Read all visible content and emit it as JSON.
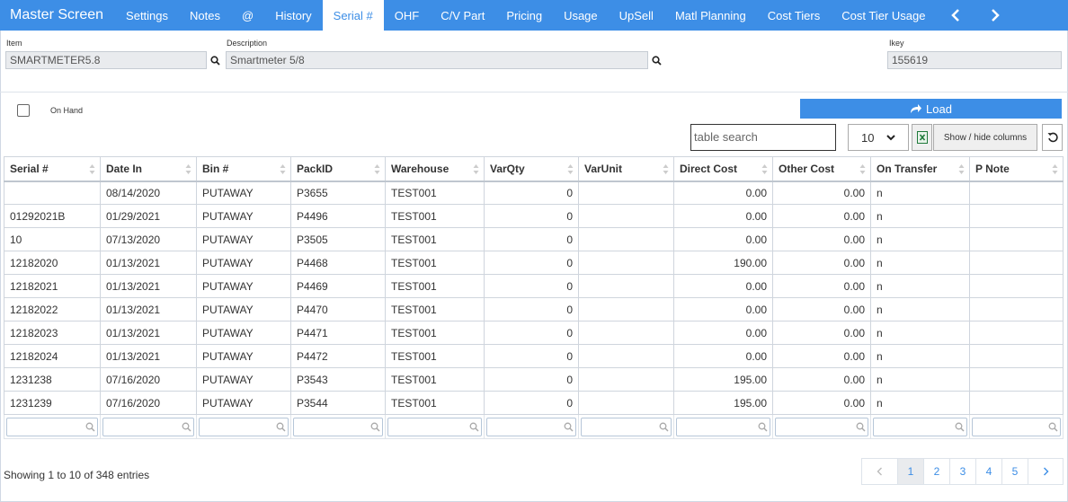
{
  "nav": {
    "brand": "Master Screen",
    "tabs": [
      "Settings",
      "Notes",
      "@",
      "History",
      "Serial #",
      "OHF",
      "C/V Part",
      "Pricing",
      "Usage",
      "UpSell",
      "Matl Planning",
      "Cost Tiers",
      "Cost Tier Usage"
    ],
    "active_tab": "Serial #"
  },
  "fields": {
    "item_label": "Item",
    "item_value": "SMARTMETER5.8",
    "description_label": "Description",
    "description_value": "Smartmeter 5/8",
    "ikey_label": "Ikey",
    "ikey_value": "155619"
  },
  "options": {
    "on_hand_label": "On Hand",
    "on_hand_checked": false
  },
  "toolbar": {
    "load_label": "Load",
    "search_placeholder": "table search",
    "page_size": "10",
    "show_hide_label": "Show / hide columns"
  },
  "table": {
    "columns": [
      "Serial #",
      "Date In",
      "Bin #",
      "PackID",
      "Warehouse",
      "VarQty",
      "VarUnit",
      "Direct Cost",
      "Other Cost",
      "On Transfer",
      "P Note"
    ],
    "rows": [
      [
        "",
        "08/14/2020",
        "PUTAWAY",
        "P3655",
        "TEST001",
        "0",
        "",
        "0.00",
        "0.00",
        "n",
        ""
      ],
      [
        "01292021B",
        "01/29/2021",
        "PUTAWAY",
        "P4496",
        "TEST001",
        "0",
        "",
        "0.00",
        "0.00",
        "n",
        ""
      ],
      [
        "10",
        "07/13/2020",
        "PUTAWAY",
        "P3505",
        "TEST001",
        "0",
        "",
        "0.00",
        "0.00",
        "n",
        ""
      ],
      [
        "12182020",
        "01/13/2021",
        "PUTAWAY",
        "P4468",
        "TEST001",
        "0",
        "",
        "190.00",
        "0.00",
        "n",
        ""
      ],
      [
        "12182021",
        "01/13/2021",
        "PUTAWAY",
        "P4469",
        "TEST001",
        "0",
        "",
        "0.00",
        "0.00",
        "n",
        ""
      ],
      [
        "12182022",
        "01/13/2021",
        "PUTAWAY",
        "P4470",
        "TEST001",
        "0",
        "",
        "0.00",
        "0.00",
        "n",
        ""
      ],
      [
        "12182023",
        "01/13/2021",
        "PUTAWAY",
        "P4471",
        "TEST001",
        "0",
        "",
        "0.00",
        "0.00",
        "n",
        ""
      ],
      [
        "12182024",
        "01/13/2021",
        "PUTAWAY",
        "P4472",
        "TEST001",
        "0",
        "",
        "0.00",
        "0.00",
        "n",
        ""
      ],
      [
        "1231238",
        "07/16/2020",
        "PUTAWAY",
        "P3543",
        "TEST001",
        "0",
        "",
        "195.00",
        "0.00",
        "n",
        ""
      ],
      [
        "1231239",
        "07/16/2020",
        "PUTAWAY",
        "P3544",
        "TEST001",
        "0",
        "",
        "195.00",
        "0.00",
        "n",
        ""
      ]
    ]
  },
  "footer": {
    "info": "Showing 1 to 10 of 348 entries",
    "pages": [
      "1",
      "2",
      "3",
      "4",
      "5"
    ],
    "current_page": "1"
  },
  "colors": {
    "accent": "#3d8ee6",
    "excel_green": "#1f7a3a"
  },
  "icons": {
    "search": "search-icon",
    "load": "share-arrow-icon",
    "excel": "excel-icon",
    "refresh": "refresh-icon",
    "prev": "chevron-left-icon",
    "next": "chevron-right-icon"
  }
}
